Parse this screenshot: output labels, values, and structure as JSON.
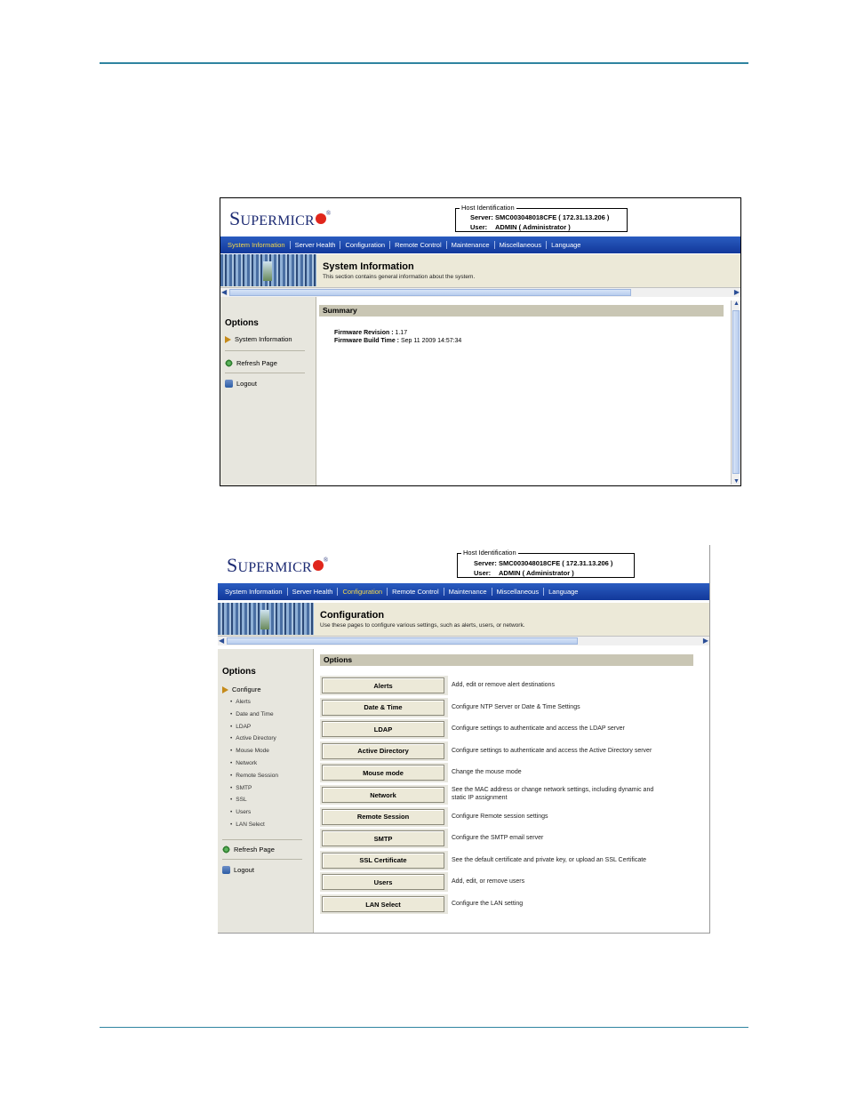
{
  "brand": {
    "logo_first": "S",
    "logo_rest": "UPERMICR",
    "logo_reg": "®"
  },
  "host": {
    "legend": "Host Identification",
    "server_label": "Server:",
    "server_value": "SMC003048018CFE (  172.31.13.206  )",
    "user_label": "User:",
    "user_value": "ADMIN          ( Administrator )"
  },
  "nav": [
    "System Information",
    "Server Health",
    "Configuration",
    "Remote Control",
    "Maintenance",
    "Miscellaneous",
    "Language"
  ],
  "shot1": {
    "nav_active": 0,
    "banner_title": "System Information",
    "banner_desc": "This section contains general information about the system.",
    "sidebar_title": "Options",
    "sidebar_main": "System Information",
    "refresh": "Refresh Page",
    "logout": "Logout",
    "section": "Summary",
    "firmware_revision_label": "Firmware Revision : ",
    "firmware_revision_value": "1.17",
    "firmware_build_label": "Firmware Build Time : ",
    "firmware_build_value": "Sep 11 2009 14:57:34"
  },
  "shot2": {
    "nav_active": 2,
    "banner_title": "Configuration",
    "banner_desc": "Use these pages to configure various settings, such as alerts, users, or network.",
    "sidebar_title": "Options",
    "sidebar_main": "Configure",
    "sub_items": [
      "Alerts",
      "Date and Time",
      "LDAP",
      "Active Directory",
      "Mouse Mode",
      "Network",
      "Remote Session",
      "SMTP",
      "SSL",
      "Users",
      "LAN Select"
    ],
    "refresh": "Refresh Page",
    "logout": "Logout",
    "section": "Options",
    "options": [
      {
        "button": "Alerts",
        "desc": "Add, edit or remove alert destinations"
      },
      {
        "button": "Date & Time",
        "desc": "Configure NTP Server or Date & Time Settings"
      },
      {
        "button": "LDAP",
        "desc": "Configure settings to authenticate and access the LDAP server"
      },
      {
        "button": "Active Directory",
        "desc": "Configure settings to authenticate and access the Active Directory server"
      },
      {
        "button": "Mouse mode",
        "desc": "Change the mouse mode"
      },
      {
        "button": "Network",
        "desc": "See the MAC address or change network settings, including dynamic and",
        "desc2": "static IP assignment"
      },
      {
        "button": "Remote Session",
        "desc": "Configure Remote session settings"
      },
      {
        "button": "SMTP",
        "desc": "Configure the SMTP email server"
      },
      {
        "button": "SSL Certificate",
        "desc": "See the default certificate and private key, or upload an SSL Certificate"
      },
      {
        "button": "Users",
        "desc": "Add, edit, or remove users"
      },
      {
        "button": "LAN Select",
        "desc": "Configure the LAN setting"
      }
    ]
  }
}
